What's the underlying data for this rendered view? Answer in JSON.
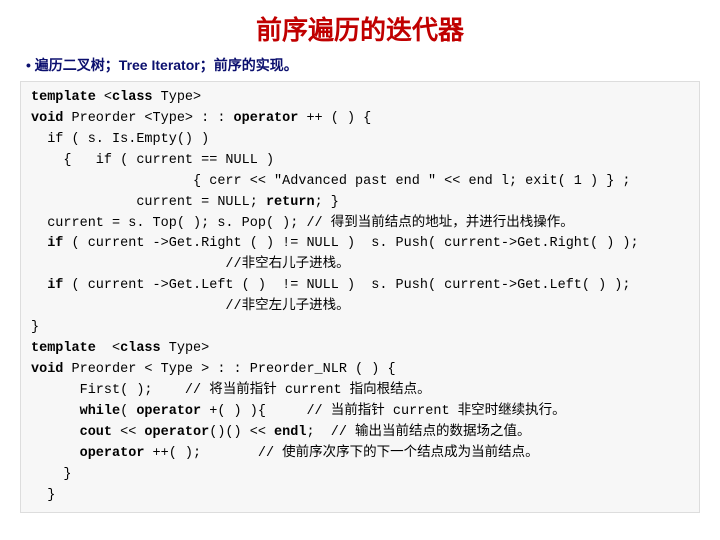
{
  "title": "前序遍历的迭代器",
  "bullet": "• 遍历二叉树；Tree Iterator；前序的实现。",
  "code": {
    "l01a": "template",
    "l01b": " <",
    "l01c": "class",
    "l01d": " Type>",
    "l02a": "void",
    "l02b": " Preorder <Type> : : ",
    "l02c": "operator",
    "l02d": " ++ ( ) {",
    "l03": "  if ( s. Is.Empty() )",
    "l04": "    {   if ( current == NULL )",
    "l05a": "                    { cerr << \"Advanced past end \" << end l; exit( 1 ) } ;",
    "l06a": "             current = NULL; ",
    "l06b": "return",
    "l06c": "; }",
    "l07": "  current = s. Top( ); s. Pop( ); // 得到当前结点的地址，并进行出栈操作。",
    "l08a": "  ",
    "l08b": "if",
    "l08c": " ( current ->Get.Right ( ) != NULL )  s. Push( current->Get.Right( ) );",
    "l09": "                        //非空右儿子进栈。",
    "l10a": "  ",
    "l10b": "if",
    "l10c": " ( current ->Get.Left ( )  != NULL )  s. Push( current->Get.Left( ) );",
    "l11": "                        //非空左儿子进栈。",
    "l12": "}",
    "l13a": "template",
    "l13b": "  <",
    "l13c": "class",
    "l13d": " Type>",
    "l14a": "void",
    "l14b": " Preorder < Type > : : Preorder_NLR ( ) {",
    "l15": "      First( );    // 将当前指针 current 指向根结点。",
    "l16a": "      ",
    "l16b": "while",
    "l16c": "( ",
    "l16d": "operator",
    "l16e": " +( ) ){     // 当前指针 current 非空时继续执行。",
    "l17a": "      ",
    "l17b": "cout",
    "l17c": " << ",
    "l17d": "operator",
    "l17e": "()() << ",
    "l17f": "endl",
    "l17g": ";  // 输出当前结点的数据场之值。",
    "l18a": "      ",
    "l18b": "operator",
    "l18c": " ++( );       // 使前序次序下的下一个结点成为当前结点。",
    "l19": "    }",
    "l20": "  }"
  }
}
